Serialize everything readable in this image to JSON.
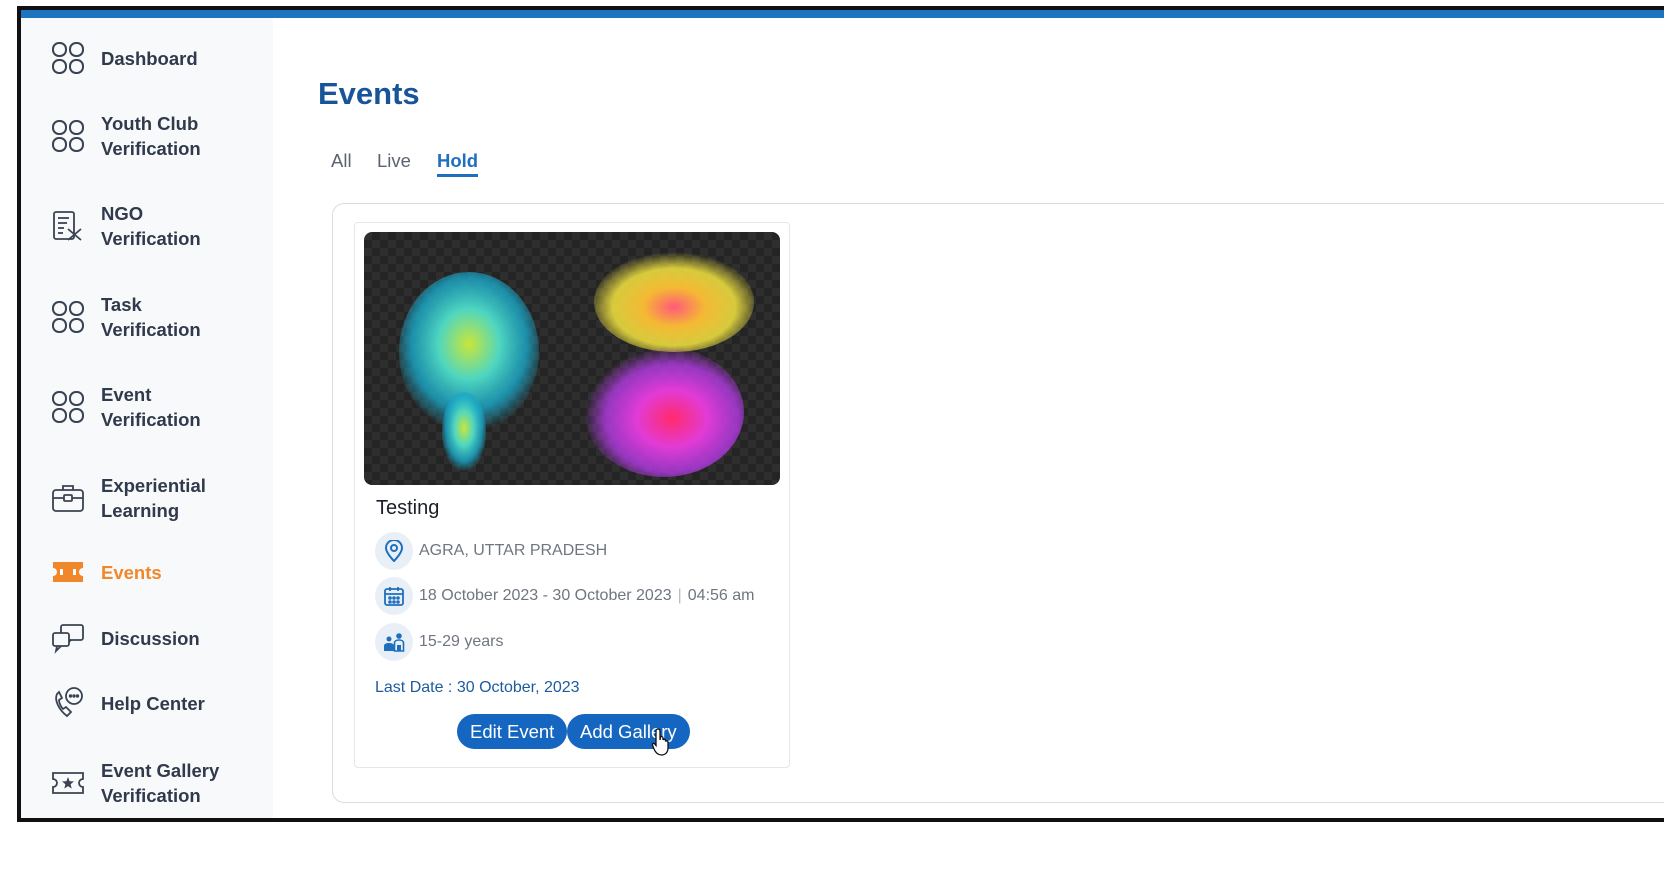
{
  "sidebar": {
    "items": [
      {
        "label": "Dashboard",
        "icon": "grid-icon"
      },
      {
        "label": "Youth Club\nVerification",
        "icon": "grid-icon"
      },
      {
        "label": "NGO\nVerification",
        "icon": "document-check-icon"
      },
      {
        "label": "Task\nVerification",
        "icon": "grid-icon"
      },
      {
        "label": "Event\nVerification",
        "icon": "grid-icon"
      },
      {
        "label": "Experiential\nLearning",
        "icon": "briefcase-icon"
      },
      {
        "label": "Events",
        "icon": "ticket-icon",
        "active": true
      },
      {
        "label": "Discussion",
        "icon": "chat-bubbles-icon"
      },
      {
        "label": "Help Center",
        "icon": "phone-chat-icon"
      },
      {
        "label": "Event Gallery\nVerification",
        "icon": "star-ticket-icon"
      }
    ]
  },
  "main": {
    "title": "Events",
    "tabs": [
      {
        "label": "All"
      },
      {
        "label": "Live"
      },
      {
        "label": "Hold",
        "active": true
      }
    ]
  },
  "card": {
    "title": "Testing",
    "location": "AGRA, UTTAR PRADESH",
    "dates": "18 October 2023 - 30 October 2023",
    "separator": "|",
    "time": "04:56 am",
    "age": "15-29 years",
    "last_date": "Last Date : 30 October, 2023",
    "edit_label": "Edit Event",
    "gallery_label": "Add Gallery",
    "icons": {
      "location": "location-pin-icon",
      "calendar": "calendar-icon",
      "age": "people-icon"
    }
  },
  "colors": {
    "accent": "#1f74c2",
    "title": "#17549a",
    "active_nav": "#f0882b",
    "button": "#1566c0"
  }
}
